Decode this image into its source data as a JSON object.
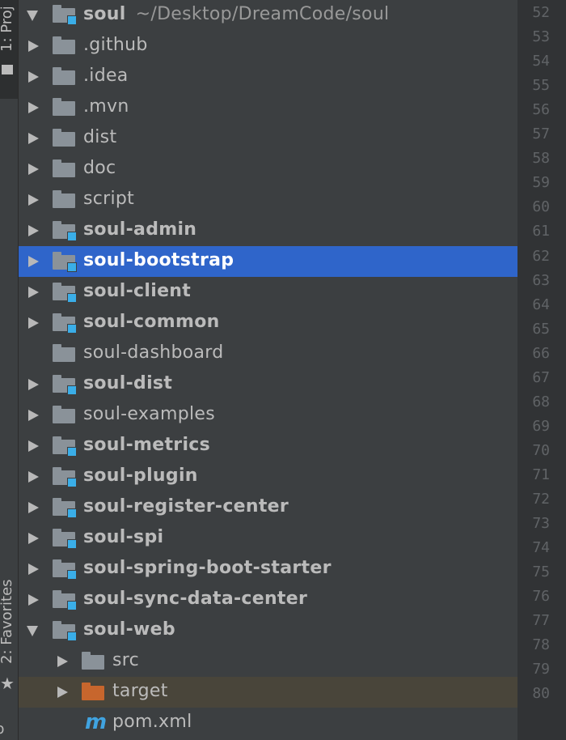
{
  "sidebar": {
    "project_tab": "1: Proj",
    "favorites_tab": "2: Favorites"
  },
  "tree": {
    "root": {
      "name": "soul",
      "path": "~/Desktop/DreamCode/soul"
    },
    "items": [
      {
        "name": ".github",
        "kind": "folder",
        "expanded": false,
        "bold": false
      },
      {
        "name": ".idea",
        "kind": "folder",
        "expanded": false,
        "bold": false
      },
      {
        "name": ".mvn",
        "kind": "folder",
        "expanded": false,
        "bold": false
      },
      {
        "name": "dist",
        "kind": "folder",
        "expanded": false,
        "bold": false
      },
      {
        "name": "doc",
        "kind": "folder",
        "expanded": false,
        "bold": false
      },
      {
        "name": "script",
        "kind": "folder",
        "expanded": false,
        "bold": false
      },
      {
        "name": "soul-admin",
        "kind": "module",
        "expanded": false,
        "bold": true
      },
      {
        "name": "soul-bootstrap",
        "kind": "module",
        "expanded": false,
        "bold": true,
        "selected": true
      },
      {
        "name": "soul-client",
        "kind": "module",
        "expanded": false,
        "bold": true
      },
      {
        "name": "soul-common",
        "kind": "module",
        "expanded": false,
        "bold": true
      },
      {
        "name": "soul-dashboard",
        "kind": "folder",
        "expanded": null,
        "bold": false
      },
      {
        "name": "soul-dist",
        "kind": "module",
        "expanded": false,
        "bold": true
      },
      {
        "name": "soul-examples",
        "kind": "folder",
        "expanded": false,
        "bold": false
      },
      {
        "name": "soul-metrics",
        "kind": "module",
        "expanded": false,
        "bold": true
      },
      {
        "name": "soul-plugin",
        "kind": "module",
        "expanded": false,
        "bold": true
      },
      {
        "name": "soul-register-center",
        "kind": "module",
        "expanded": false,
        "bold": true
      },
      {
        "name": "soul-spi",
        "kind": "module",
        "expanded": false,
        "bold": true
      },
      {
        "name": "soul-spring-boot-starter",
        "kind": "module",
        "expanded": false,
        "bold": true
      },
      {
        "name": "soul-sync-data-center",
        "kind": "module",
        "expanded": false,
        "bold": true
      },
      {
        "name": "soul-web",
        "kind": "module",
        "expanded": true,
        "bold": true
      },
      {
        "name": "src",
        "kind": "folder",
        "expanded": false,
        "bold": false,
        "depth": 1
      },
      {
        "name": "target",
        "kind": "excluded-folder",
        "expanded": false,
        "bold": false,
        "depth": 1,
        "highlight": true
      },
      {
        "name": "pom.xml",
        "kind": "maven-file",
        "expanded": null,
        "bold": false,
        "depth": 1
      }
    ]
  },
  "gutter": {
    "line_numbers": [
      "52",
      "53",
      "54",
      "55",
      "56",
      "57",
      "58",
      "59",
      "60",
      "61",
      "62",
      "63",
      "64",
      "65",
      "66",
      "67",
      "68",
      "69",
      "70",
      "71",
      "72",
      "73",
      "74",
      "75",
      "76",
      "77",
      "78",
      "79",
      "80"
    ]
  },
  "colors": {
    "selection": "#2f65ca",
    "module_badge": "#3aaee8",
    "excluded_folder": "#c7662d",
    "maven_icon": "#40a3e0"
  }
}
